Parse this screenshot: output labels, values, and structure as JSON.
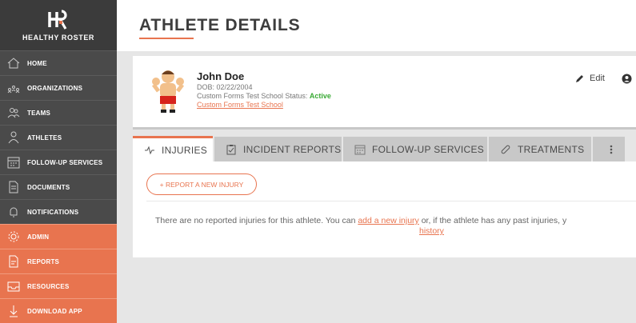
{
  "brand": {
    "name": "HEALTHY ROSTER"
  },
  "sidebar": {
    "items": [
      {
        "label": "HOME",
        "icon": "home-icon"
      },
      {
        "label": "ORGANIZATIONS",
        "icon": "organizations-icon"
      },
      {
        "label": "TEAMS",
        "icon": "teams-icon"
      },
      {
        "label": "ATHLETES",
        "icon": "athlete-icon"
      },
      {
        "label": "FOLLOW-UP SERVICES",
        "icon": "calendar-icon"
      },
      {
        "label": "DOCUMENTS",
        "icon": "document-icon"
      },
      {
        "label": "NOTIFICATIONS",
        "icon": "bell-icon"
      },
      {
        "label": "ADMIN",
        "icon": "gear-icon"
      },
      {
        "label": "REPORTS",
        "icon": "report-icon"
      },
      {
        "label": "RESOURCES",
        "icon": "inbox-icon"
      },
      {
        "label": "DOWNLOAD APP",
        "icon": "download-icon"
      }
    ]
  },
  "page": {
    "title": "ATHLETE DETAILS"
  },
  "athlete": {
    "name": "John Doe",
    "dob": "DOB: 02/22/2004",
    "status_prefix": "Custom Forms Test School Status: ",
    "status": "Active",
    "school": "Custom Forms Test School",
    "edit_label": "Edit"
  },
  "tabs": [
    {
      "label": "INJURIES",
      "icon": "pulse-icon"
    },
    {
      "label": "INCIDENT REPORTS",
      "icon": "clipboard-icon"
    },
    {
      "label": "FOLLOW-UP SERVICES",
      "icon": "calendar-icon"
    },
    {
      "label": "TREATMENTS",
      "icon": "bandage-icon"
    }
  ],
  "injuries": {
    "report_button": "+ REPORT A NEW INJURY",
    "empty_text_1": "There are no reported injuries for this athlete. You can ",
    "add_link": "add a new injury",
    "empty_text_2": " or, if the athlete has any past injuries, y",
    "history_link": "history"
  },
  "colors": {
    "accent": "#e8744f",
    "sidebar": "#4a4a4a",
    "active_status": "#3aaa35"
  }
}
